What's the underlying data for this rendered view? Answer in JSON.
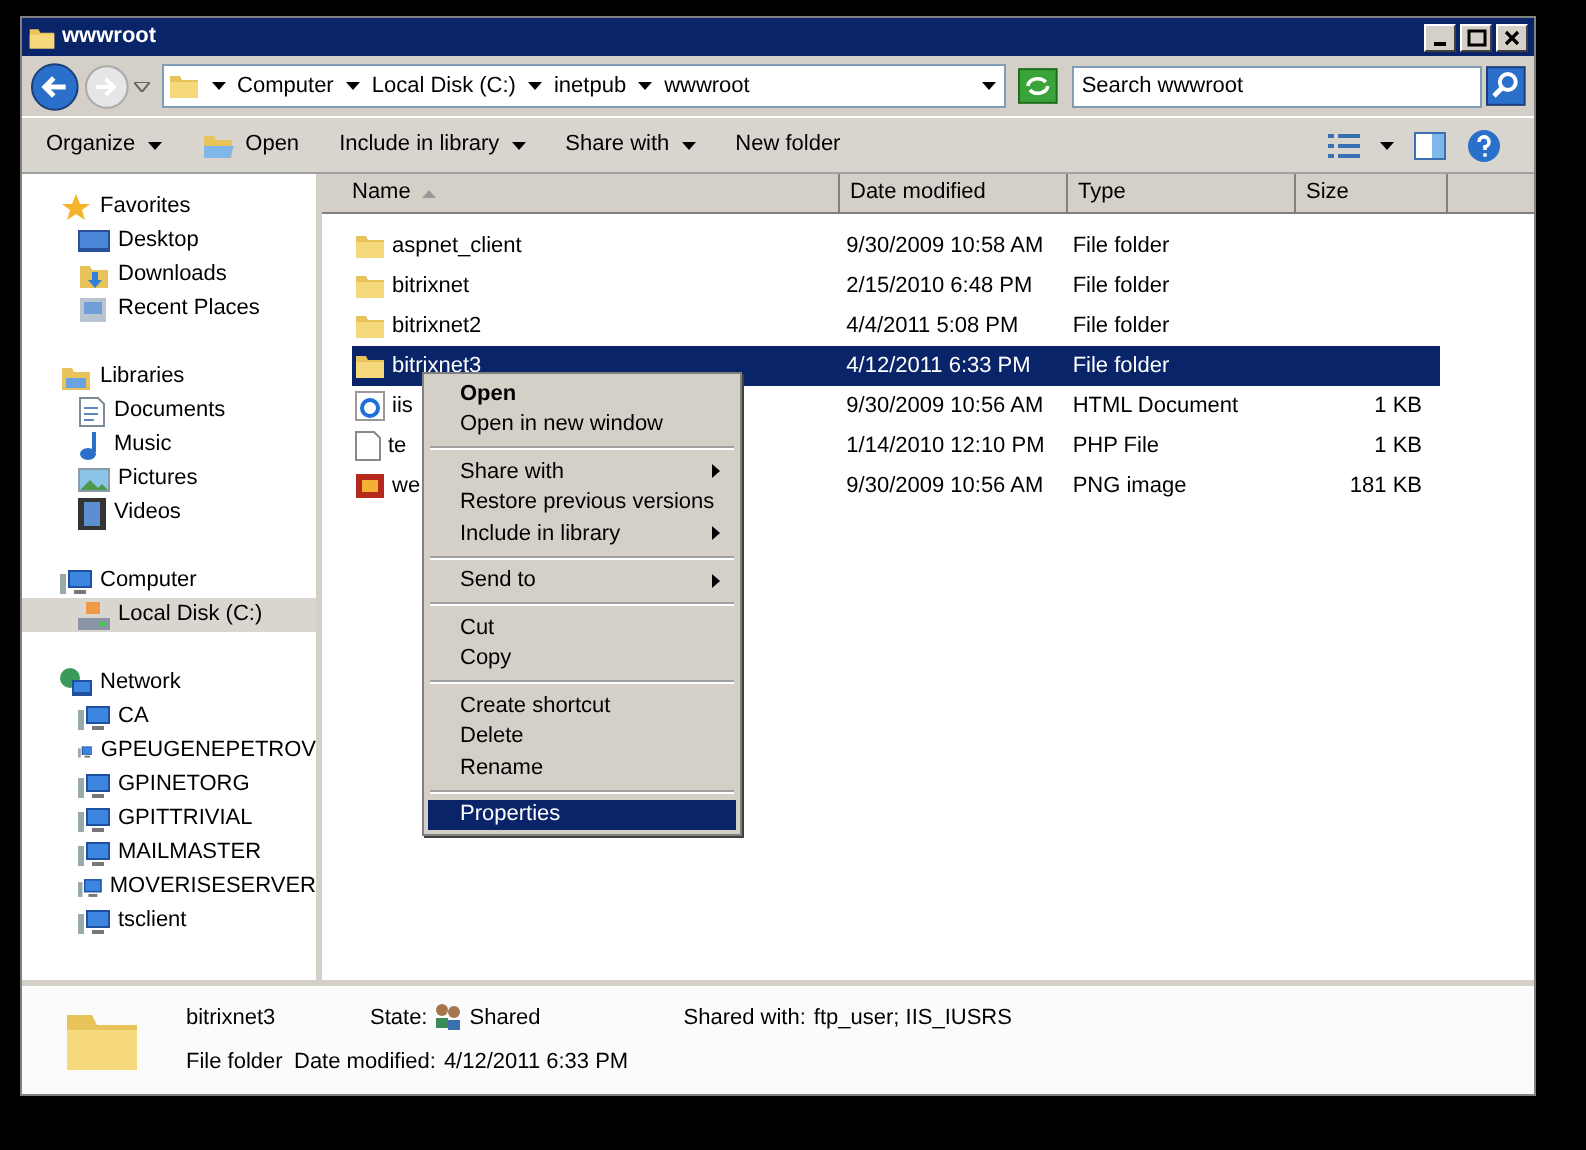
{
  "window": {
    "title": "wwwroot"
  },
  "address_bar": {
    "crumbs": [
      "Computer",
      "Local Disk (C:)",
      "inetpub",
      "wwwroot"
    ]
  },
  "search": {
    "placeholder": "Search wwwroot"
  },
  "toolbar": [
    {
      "label": "Organize",
      "kind": "menu"
    },
    {
      "label": "Open",
      "kind": "icon"
    },
    {
      "label": "Include in library",
      "kind": "menu"
    },
    {
      "label": "Share with",
      "kind": "menu"
    },
    {
      "label": "New folder",
      "kind": "plain"
    }
  ],
  "sidebar": {
    "groups": [
      {
        "label": "Favorites",
        "kind": "favorites",
        "children": [
          {
            "label": "Desktop",
            "kind": "desktop",
            "selected": false
          },
          {
            "label": "Downloads",
            "kind": "downloads",
            "selected": false
          },
          {
            "label": "Recent Places",
            "kind": "recent",
            "selected": false
          }
        ]
      },
      {
        "label": "Libraries",
        "kind": "libraries",
        "children": [
          {
            "label": "Documents",
            "kind": "documents",
            "selected": false
          },
          {
            "label": "Music",
            "kind": "music",
            "selected": false
          },
          {
            "label": "Pictures",
            "kind": "pictures",
            "selected": false
          },
          {
            "label": "Videos",
            "kind": "videos",
            "selected": false
          }
        ]
      },
      {
        "label": "Computer",
        "kind": "computer",
        "children": [
          {
            "label": "Local Disk (C:)",
            "kind": "disk",
            "selected": true
          }
        ]
      },
      {
        "label": "Network",
        "kind": "network",
        "children": [
          {
            "label": "CA",
            "kind": "pc",
            "selected": false
          },
          {
            "label": "GPEUGENEPETROV",
            "kind": "pc",
            "selected": false
          },
          {
            "label": "GPINETORG",
            "kind": "pc",
            "selected": false
          },
          {
            "label": "GPITTRIVIAL",
            "kind": "pc",
            "selected": false
          },
          {
            "label": "MAILMASTER",
            "kind": "pc",
            "selected": false
          },
          {
            "label": "MOVERISESERVER",
            "kind": "pc",
            "selected": false
          },
          {
            "label": "tsclient",
            "kind": "pc",
            "selected": false
          }
        ]
      }
    ]
  },
  "columns": [
    {
      "label": "Name",
      "sorted": true
    },
    {
      "label": "Date modified",
      "sorted": false
    },
    {
      "label": "Type",
      "sorted": false
    },
    {
      "label": "Size",
      "sorted": false
    }
  ],
  "files": [
    {
      "name": "aspnet_client",
      "date": "9/30/2009 10:58 AM",
      "type": "File folder",
      "kind": "folder",
      "selected": false
    },
    {
      "name": "bitrixnet",
      "date": "2/15/2010 6:48 PM",
      "type": "File folder",
      "kind": "folder",
      "selected": false
    },
    {
      "name": "bitrixnet2",
      "date": "4/4/2011 5:08 PM",
      "type": "File folder",
      "kind": "folder",
      "selected": false
    },
    {
      "name": "bitrixnet3",
      "date": "4/12/2011 6:33 PM",
      "type": "File folder",
      "kind": "folder",
      "selected": true
    },
    {
      "name": "iis",
      "date": "9/30/2009 10:56 AM",
      "type": "HTML Document",
      "size": "1 KB",
      "kind": "html",
      "selected": false
    },
    {
      "name": "te",
      "date": "1/14/2010 12:10 PM",
      "type": "PHP File",
      "size": "1 KB",
      "kind": "php",
      "selected": false
    },
    {
      "name": "we",
      "date": "9/30/2009 10:56 AM",
      "type": "PNG image",
      "size": "181 KB",
      "kind": "png",
      "selected": false
    }
  ],
  "context_menu": {
    "groups": [
      [
        {
          "label": "Open",
          "default": true,
          "submenu": false,
          "selected": false
        },
        {
          "label": "Open in new window",
          "default": false,
          "submenu": false,
          "selected": false
        }
      ],
      [
        {
          "label": "Share with",
          "default": false,
          "submenu": true,
          "selected": false
        },
        {
          "label": "Restore previous versions",
          "default": false,
          "submenu": false,
          "selected": false
        },
        {
          "label": "Include in library",
          "default": false,
          "submenu": true,
          "selected": false
        }
      ],
      [
        {
          "label": "Send to",
          "default": false,
          "submenu": true,
          "selected": false
        }
      ],
      [
        {
          "label": "Cut",
          "default": false,
          "submenu": false,
          "selected": false
        },
        {
          "label": "Copy",
          "default": false,
          "submenu": false,
          "selected": false
        }
      ],
      [
        {
          "label": "Create shortcut",
          "default": false,
          "submenu": false,
          "selected": false
        },
        {
          "label": "Delete",
          "default": false,
          "submenu": false,
          "selected": false
        },
        {
          "label": "Rename",
          "default": false,
          "submenu": false,
          "selected": false
        }
      ],
      [
        {
          "label": "Properties",
          "default": false,
          "submenu": false,
          "selected": true
        }
      ]
    ]
  },
  "details": {
    "name": "bitrixnet3",
    "type": "File folder",
    "state_label": "State:",
    "state": "Shared",
    "shared_with_label": "Shared with:",
    "shared_with": "ftp_user; IIS_IUSRS",
    "date_label": "Date modified:",
    "date": "4/12/2011 6:33 PM"
  }
}
